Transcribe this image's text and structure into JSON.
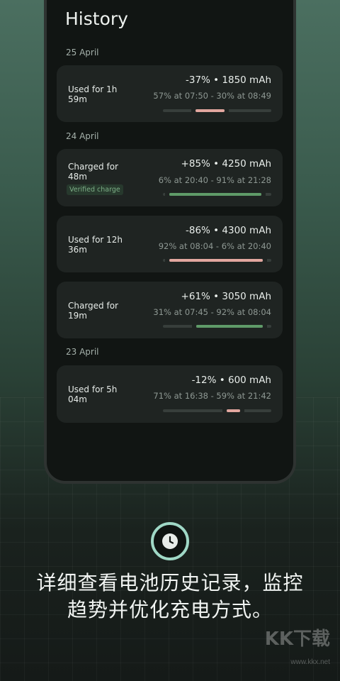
{
  "screen": {
    "title": "History",
    "groups": [
      {
        "date": "25 April",
        "entries": [
          {
            "label": "Used for 1h 59m",
            "summary": "-37% • 1850 mAh",
            "detail": "57% at 07:50 - 30% at 08:49",
            "badge": "",
            "kind": "discharge",
            "from_pct": 57,
            "to_pct": 30
          }
        ]
      },
      {
        "date": "24 April",
        "entries": [
          {
            "label": "Charged for 48m",
            "summary": "+85% • 4250 mAh",
            "detail": "6% at 20:40 - 91% at 21:28",
            "badge": "Verified charge",
            "kind": "charge",
            "from_pct": 6,
            "to_pct": 91
          },
          {
            "label": "Used for 12h 36m",
            "summary": "-86% • 4300 mAh",
            "detail": "92% at 08:04 - 6% at 20:40",
            "badge": "",
            "kind": "discharge",
            "from_pct": 92,
            "to_pct": 6
          },
          {
            "label": "Charged for 19m",
            "summary": "+61% • 3050 mAh",
            "detail": "31% at 07:45 - 92% at 08:04",
            "badge": "",
            "kind": "charge",
            "from_pct": 31,
            "to_pct": 92
          }
        ]
      },
      {
        "date": "23 April",
        "entries": [
          {
            "label": "Used for 5h 04m",
            "summary": "-12% • 600 mAh",
            "detail": "71% at 16:38 - 59% at 21:42",
            "badge": "",
            "kind": "discharge",
            "from_pct": 71,
            "to_pct": 59
          }
        ]
      }
    ]
  },
  "promo": {
    "icon": "clock-icon",
    "caption_line1": "详细查看电池历史记录，监控",
    "caption_line2": "趋势并优化充电方式。"
  },
  "watermark": {
    "logo": "KK下载",
    "url": "www.kkx.net"
  },
  "colors": {
    "discharge": "#e2a79f",
    "charge": "#5f9b68",
    "accent": "#9fd8c6"
  }
}
